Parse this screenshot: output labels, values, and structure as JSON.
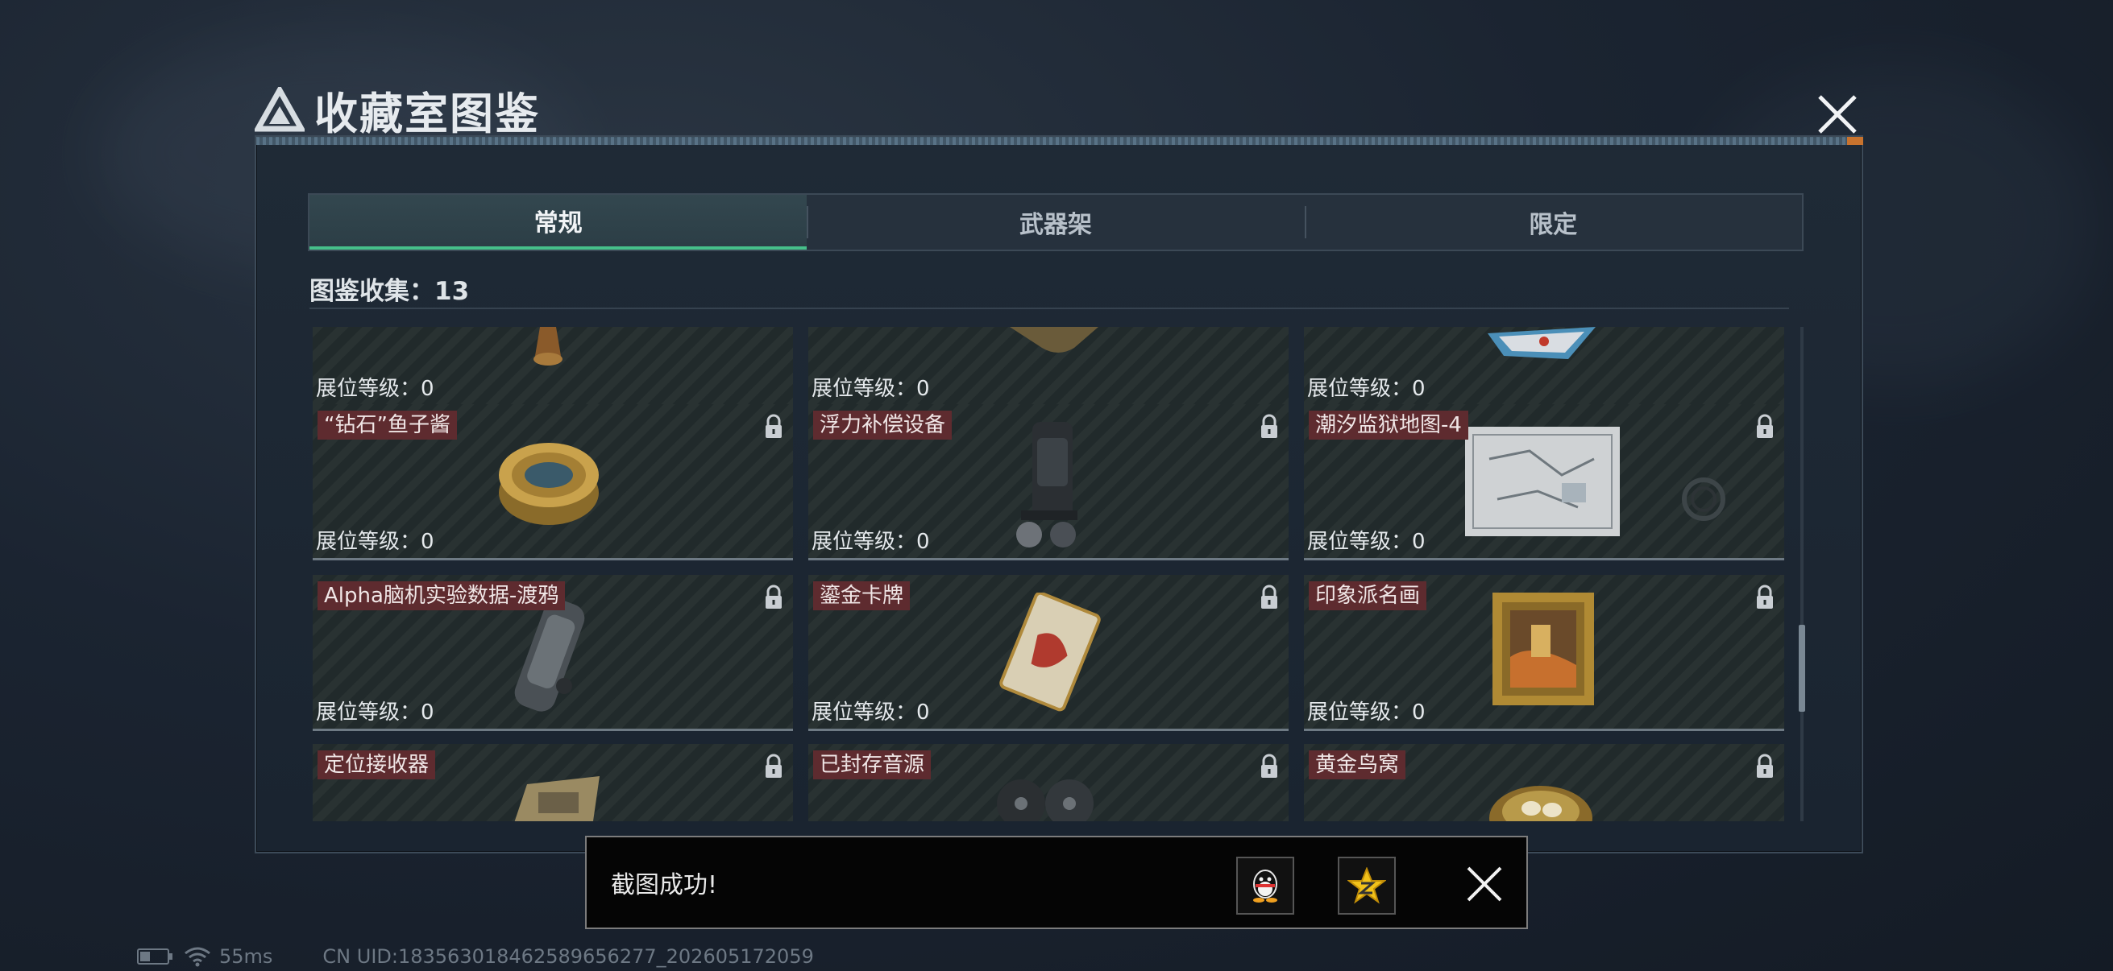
{
  "header": {
    "title": "收藏室图鉴",
    "close_icon": "close-icon"
  },
  "tabs": [
    {
      "label": "常规",
      "active": true
    },
    {
      "label": "武器架",
      "active": false
    },
    {
      "label": "限定",
      "active": false
    }
  ],
  "collection": {
    "label": "图鉴收集：13"
  },
  "cards": [
    {
      "name": "",
      "level": "展位等级：0",
      "locked": false
    },
    {
      "name": "",
      "level": "展位等级：0",
      "locked": false
    },
    {
      "name": "",
      "level": "展位等级：0",
      "locked": false
    },
    {
      "name": "“钻石”鱼子酱",
      "level": "展位等级：0",
      "locked": true
    },
    {
      "name": "浮力补偿设备",
      "level": "展位等级：0",
      "locked": true
    },
    {
      "name": "潮汐监狱地图-4",
      "level": "展位等级：0",
      "locked": true
    },
    {
      "name": "Alpha脑机实验数据-渡鸦",
      "level": "展位等级：0",
      "locked": true
    },
    {
      "name": "鎏金卡牌",
      "level": "展位等级：0",
      "locked": true
    },
    {
      "name": "印象派名画",
      "level": "展位等级：0",
      "locked": true
    },
    {
      "name": "定位接收器",
      "level": "",
      "locked": true
    },
    {
      "name": "已封存音源",
      "level": "",
      "locked": true
    },
    {
      "name": "黄金鸟窝",
      "level": "",
      "locked": true
    }
  ],
  "toast": {
    "message": "截图成功!",
    "share_qq_icon": "qq-penguin-icon",
    "share_favorite_icon": "star-favorite-icon"
  },
  "status_bar": {
    "ping": "55ms",
    "uid": "CN UID:183563018462589656277_202605172059"
  },
  "colors": {
    "accent_green": "#46c08a",
    "name_tag": "#5e2b2f",
    "modal_bg": "#1f2a36"
  }
}
